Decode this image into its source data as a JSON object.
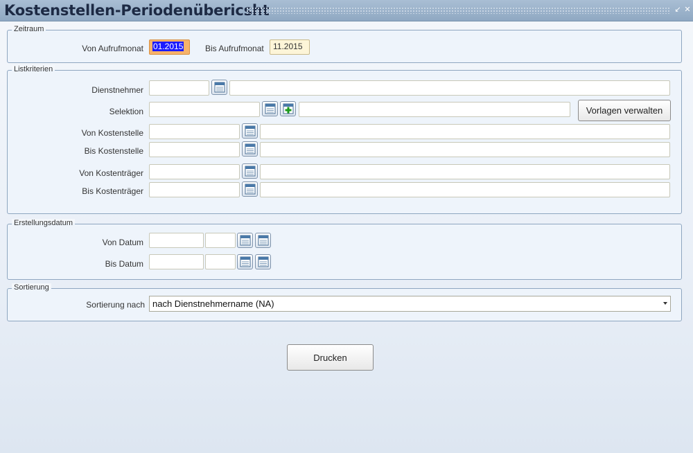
{
  "window": {
    "title": "Kostenstellen-Periodenübericsht",
    "minimize_icon": "minimize-icon",
    "close_icon": "close-icon"
  },
  "zeitraum": {
    "legend": "Zeitraum",
    "von_label": "Von Aufrufmonat",
    "von_value": "01.2015",
    "bis_label": "Bis Aufrufmonat",
    "bis_value": "11.2015"
  },
  "listkriterien": {
    "legend": "Listkriterien",
    "dienstnehmer_label": "Dienstnehmer",
    "selektion_label": "Selektion",
    "vorlagen_button": "Vorlagen verwalten",
    "von_kostenstelle_label": "Von Kostenstelle",
    "bis_kostenstelle_label": "Bis Kostenstelle",
    "von_kostentraeger_label": "Von Kostenträger",
    "bis_kostentraeger_label": "Bis Kostenträger"
  },
  "erstellungsdatum": {
    "legend": "Erstellungsdatum",
    "von_label": "Von Datum",
    "bis_label": "Bis Datum"
  },
  "sortierung": {
    "legend": "Sortierung",
    "label": "Sortierung nach",
    "selected": "nach Dienstnehmername (NA)"
  },
  "actions": {
    "print_button": "Drucken"
  },
  "icons": {
    "lookup": "list-lookup-icon",
    "add": "add-plus-icon",
    "calendar": "calendar-icon"
  },
  "colors": {
    "titlebar": "#8fa8c2",
    "selection": "#1a1aff",
    "selected_field": "#f7b36a",
    "readonly_field": "#fdf5d8",
    "add_icon": "#1b9a1b"
  }
}
